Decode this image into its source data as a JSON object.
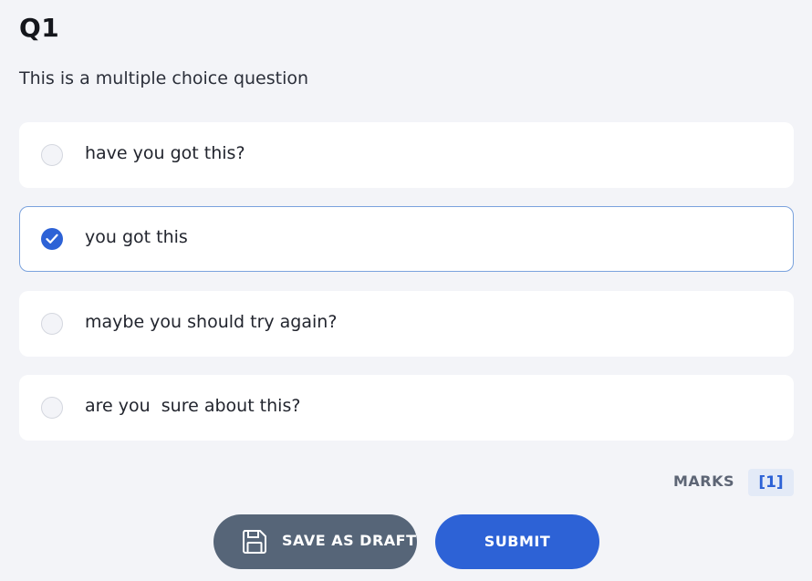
{
  "question": {
    "title": "Q1",
    "text": "This is a multiple choice question"
  },
  "options": [
    {
      "label": "have you got this?",
      "selected": false
    },
    {
      "label": "you got this",
      "selected": true
    },
    {
      "label": "maybe you should try again?",
      "selected": false
    },
    {
      "label": "are you  sure about this?",
      "selected": false
    }
  ],
  "marks": {
    "label": "MARKS",
    "value": "[1]"
  },
  "actions": {
    "save_draft_label": "SAVE AS DRAFT",
    "save_draft_icon": "save-icon",
    "submit_label": "SUBMIT"
  },
  "colors": {
    "accent": "#2d62d6",
    "draft_button": "#566578",
    "background": "#f3f4f8",
    "selected_border": "#7aa2dd"
  }
}
